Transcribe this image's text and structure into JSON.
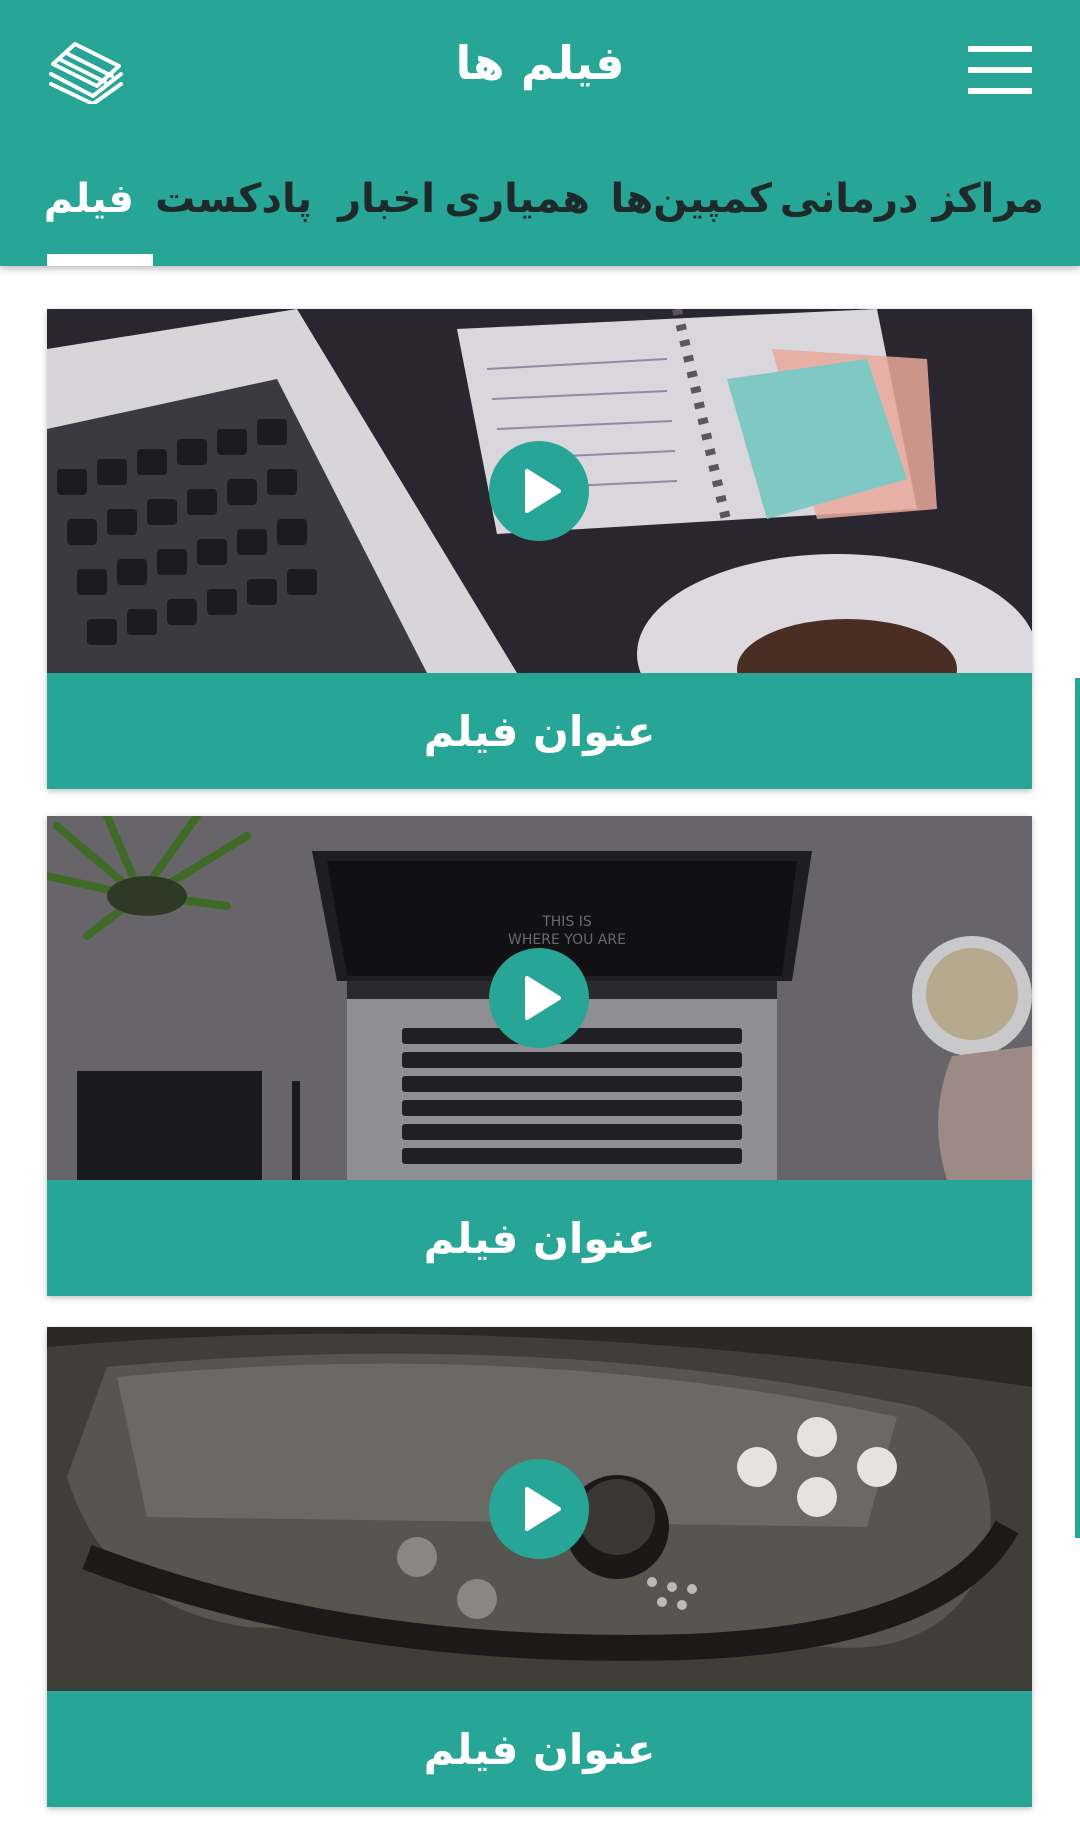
{
  "header": {
    "title": "فیلم ها",
    "logo_icon": "striped-stack-logo",
    "menu_icon": "hamburger-menu-icon"
  },
  "tabs": [
    {
      "label": "مراکز درمانی",
      "active": false
    },
    {
      "label": "کمپین‌ها",
      "active": false
    },
    {
      "label": "همیاری",
      "active": false
    },
    {
      "label": "اخبار",
      "active": false
    },
    {
      "label": "پادکست",
      "active": false
    },
    {
      "label": "فیلم",
      "active": true
    }
  ],
  "cards": [
    {
      "title": "عنوان فیلم",
      "thumbnail": "laptop-and-planner-on-desk"
    },
    {
      "title": "عنوان فیلم",
      "thumbnail": "laptop-coffee-plant-on-desk"
    },
    {
      "title": "عنوان فیلم",
      "thumbnail": "handheld-game-console-closeup"
    }
  ],
  "colors": {
    "accent": "#27a597",
    "tab_text": "#1e2a2a",
    "caption_text": "#ffffff"
  }
}
